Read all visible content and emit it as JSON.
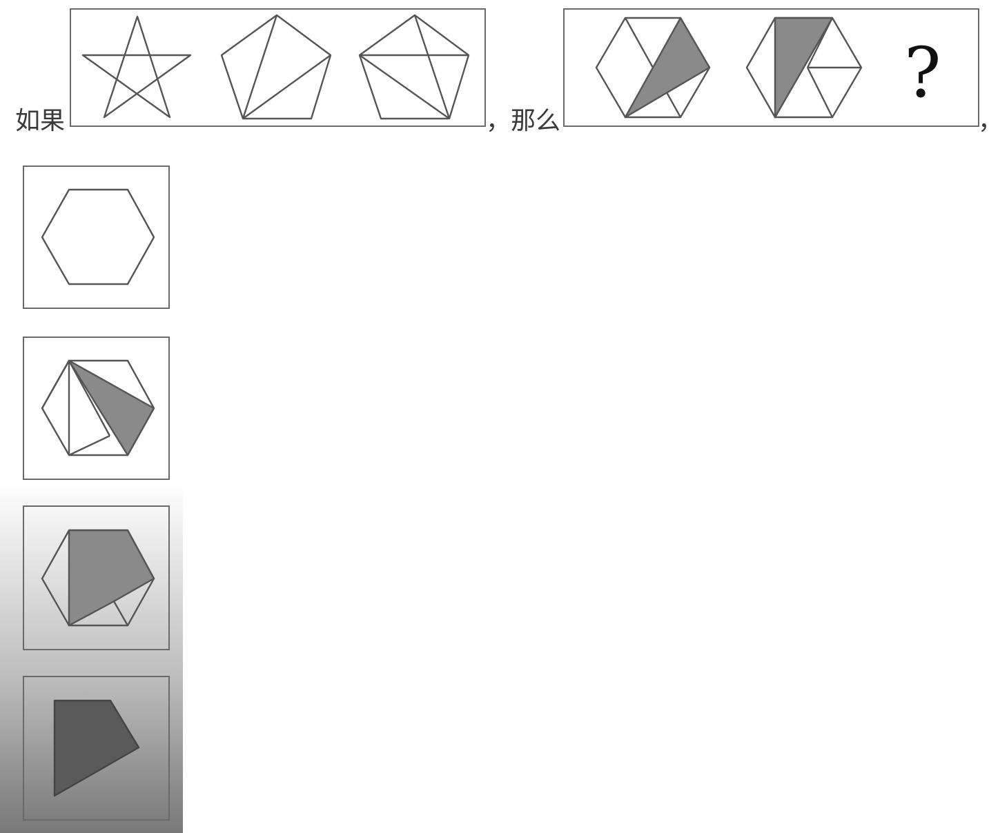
{
  "question": {
    "prefix": "如果",
    "middle": "，那么",
    "suffix": "，"
  },
  "sequence_b": {
    "unknown_symbol": "?"
  },
  "options": [
    {
      "name": "option-a"
    },
    {
      "name": "option-b"
    },
    {
      "name": "option-c"
    },
    {
      "name": "option-d"
    }
  ]
}
